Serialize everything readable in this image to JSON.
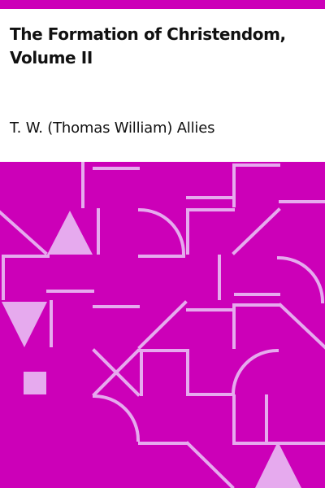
{
  "cover": {
    "title": "The Formation of Christendom, Volume II",
    "author": "T. W. (Thomas William) Allies"
  },
  "colors": {
    "background": "#ffffff",
    "accent": "#cc00b8",
    "pattern_line": "#e6aaee",
    "text": "#111111"
  }
}
